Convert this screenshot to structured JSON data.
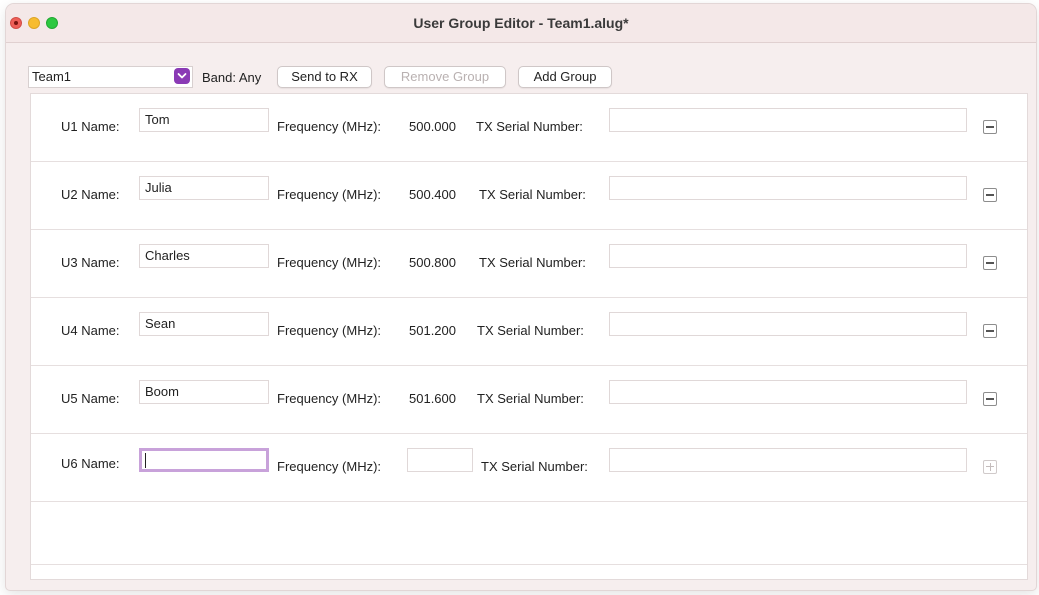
{
  "window": {
    "title": "User Group Editor - Team1.alug*"
  },
  "toolbar": {
    "group_select_value": "Team1",
    "band_label": "Band: Any",
    "send_to_rx": "Send to RX",
    "remove_group": "Remove Group",
    "add_group": "Add Group"
  },
  "labels": {
    "frequency": "Frequency (MHz):",
    "serial": "TX Serial Number:"
  },
  "rows": [
    {
      "label": "U1 Name:",
      "name": "Tom",
      "frequency": "500.000",
      "serial": "",
      "action": "remove"
    },
    {
      "label": "U2 Name:",
      "name": "Julia",
      "frequency": "500.400",
      "serial": "",
      "action": "remove"
    },
    {
      "label": "U3 Name:",
      "name": "Charles",
      "frequency": "500.800",
      "serial": "",
      "action": "remove"
    },
    {
      "label": "U4 Name:",
      "name": "Sean",
      "frequency": "501.200",
      "serial": "",
      "action": "remove"
    },
    {
      "label": "U5 Name:",
      "name": "Boom",
      "frequency": "501.600",
      "serial": "",
      "action": "remove"
    },
    {
      "label": "U6 Name:",
      "name": "",
      "frequency": "",
      "serial": "",
      "action": "add"
    }
  ],
  "colors": {
    "accent": "#8a3ab5",
    "focus_ring": "#c8a2da",
    "window_bg": "#f6eeee"
  },
  "icons": {
    "dropdown": "chevron-down-icon",
    "remove": "minus-icon",
    "add": "plus-icon"
  }
}
